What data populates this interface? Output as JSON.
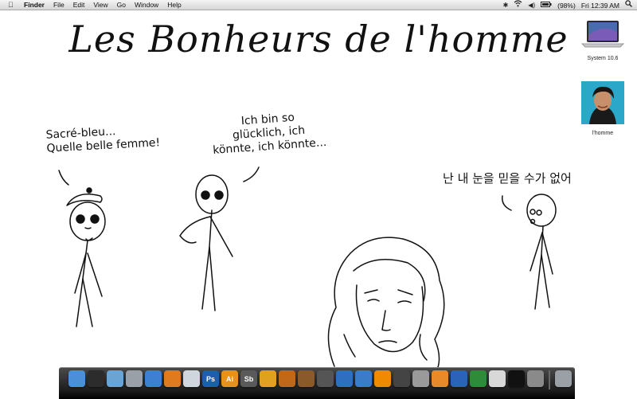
{
  "menubar": {
    "apple_icon": "apple-icon",
    "menus": [
      "Finder",
      "File",
      "Edit",
      "View",
      "Go",
      "Window",
      "Help"
    ],
    "battery": "(98%)",
    "clock": "Fri 12:39 AM"
  },
  "title": "Les Bonheurs de l'homme",
  "desktop_icons": [
    {
      "label": "System 10.6",
      "icon": "laptop-icon"
    },
    {
      "label": "l'homme",
      "icon": "photo-icon"
    }
  ],
  "comic": {
    "speech_1": [
      "Sacré-bleu...",
      "Quelle belle femme!"
    ],
    "speech_2": [
      "Ich bin so",
      "glücklich, ich",
      "könnte, ich könnte..."
    ],
    "speech_3": "난 내 눈을 믿을 수가 없어"
  },
  "dock": {
    "items": [
      {
        "icon": "finder-icon",
        "color": "#4a8fd8",
        "glyph": ""
      },
      {
        "icon": "dashboard-icon",
        "color": "#2c2c2c",
        "glyph": ""
      },
      {
        "icon": "preview-icon",
        "color": "#6aa4d4",
        "glyph": ""
      },
      {
        "icon": "facetime-icon",
        "color": "#9aa0a8",
        "glyph": ""
      },
      {
        "icon": "safari-icon",
        "color": "#3d7fd0",
        "glyph": ""
      },
      {
        "icon": "firefox-icon",
        "color": "#e07a1f",
        "glyph": ""
      },
      {
        "icon": "mail-icon",
        "color": "#cfd6de",
        "glyph": ""
      },
      {
        "icon": "photoshop-icon",
        "color": "#1d5fa8",
        "glyph": "Ps"
      },
      {
        "icon": "illustrator-icon",
        "color": "#e8911a",
        "glyph": "Ai"
      },
      {
        "icon": "soundbooth-icon",
        "color": "#5a5a5a",
        "glyph": "Sb"
      },
      {
        "icon": "itunes-music-icon",
        "color": "#e0a020",
        "glyph": ""
      },
      {
        "icon": "audio-icon",
        "color": "#c06818",
        "glyph": ""
      },
      {
        "icon": "guitar-icon",
        "color": "#8a5a2a",
        "glyph": ""
      },
      {
        "icon": "network-icon",
        "color": "#555",
        "glyph": ""
      },
      {
        "icon": "itunes-icon",
        "color": "#2f6fbf",
        "glyph": ""
      },
      {
        "icon": "quicktime-icon",
        "color": "#3a7cc8",
        "glyph": ""
      },
      {
        "icon": "vlc-icon",
        "color": "#f08a00",
        "glyph": ""
      },
      {
        "icon": "clapper-icon",
        "color": "#444",
        "glyph": ""
      },
      {
        "icon": "textedit-icon",
        "color": "#9a9a9a",
        "glyph": ""
      },
      {
        "icon": "pages-icon",
        "color": "#e88a2a",
        "glyph": ""
      },
      {
        "icon": "word-icon",
        "color": "#2b63b8",
        "glyph": ""
      },
      {
        "icon": "excel-icon",
        "color": "#2e8b3a",
        "glyph": ""
      },
      {
        "icon": "document-icon",
        "color": "#d8d8d8",
        "glyph": ""
      },
      {
        "icon": "terminal-icon",
        "color": "#111",
        "glyph": ""
      },
      {
        "icon": "system-prefs-icon",
        "color": "#8a8a8a",
        "glyph": ""
      },
      {
        "icon": "trash-icon",
        "color": "#9aa0a6",
        "glyph": ""
      }
    ]
  }
}
